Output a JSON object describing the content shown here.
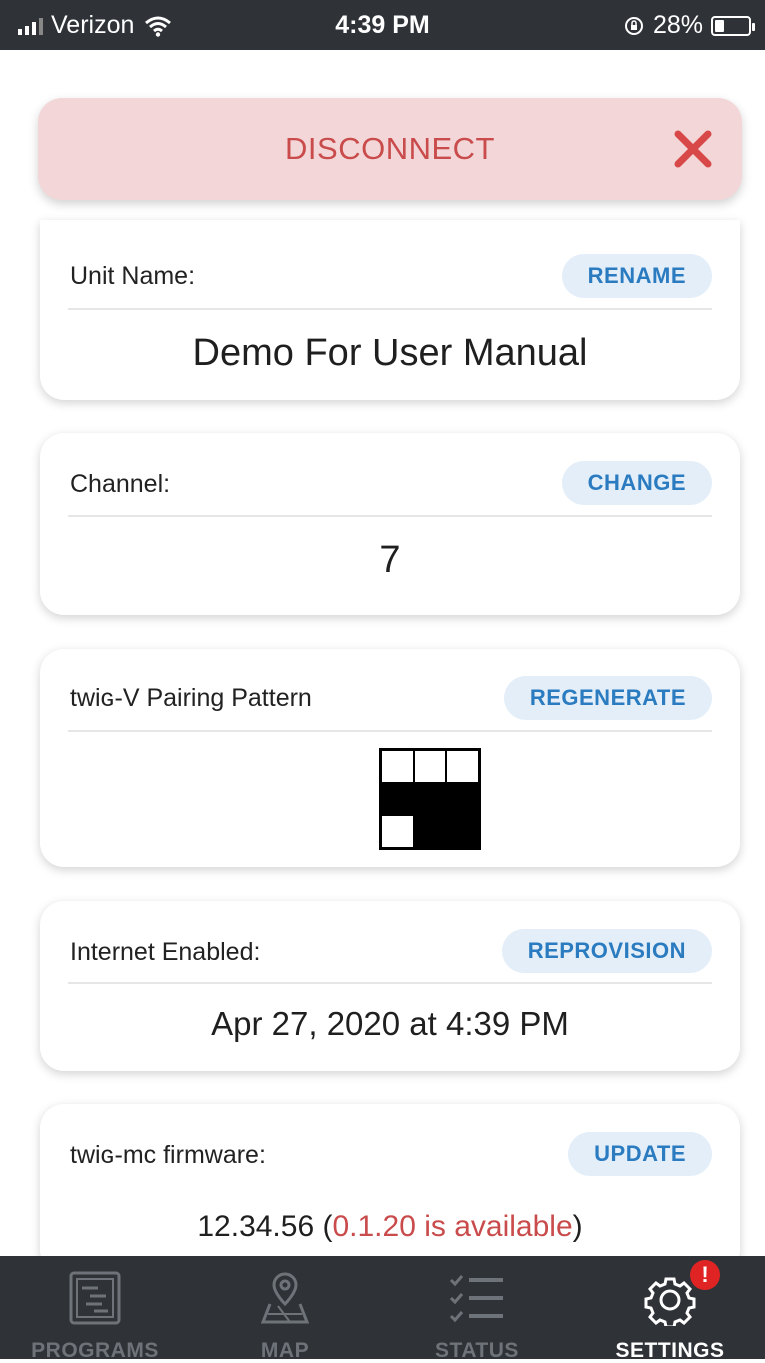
{
  "status_bar": {
    "carrier": "Verizon",
    "time": "4:39 PM",
    "battery": "28%",
    "battery_level": 0.28
  },
  "disconnect": {
    "label": "DISCONNECT",
    "close_icon": "close-icon",
    "color": "#c94b4b"
  },
  "unit": {
    "label": "Unit Name:",
    "button": "RENAME",
    "value": "Demo For User Manual"
  },
  "channel": {
    "label": "Channel:",
    "button": "CHANGE",
    "value": "7"
  },
  "pairing": {
    "label": "twiɢ-V Pairing Pattern",
    "button": "REGENERATE",
    "pattern": [
      [
        0,
        0,
        0
      ],
      [
        1,
        1,
        1
      ],
      [
        0,
        1,
        1
      ]
    ]
  },
  "internet": {
    "label": "Internet Enabled:",
    "button": "REPROVISION",
    "value": "Apr 27, 2020 at 4:39 PM"
  },
  "firmware": {
    "label": "twiɢ-mc firmware:",
    "button": "UPDATE",
    "current": "12.34.56",
    "open": " (",
    "available": "0.1.20 is available",
    "close": ")"
  },
  "tabs": [
    {
      "label": "PROGRAMS",
      "icon": "programs-icon",
      "active": false
    },
    {
      "label": "MAP",
      "icon": "map-pin-icon",
      "active": false
    },
    {
      "label": "STATUS",
      "icon": "checklist-icon",
      "active": false
    },
    {
      "label": "SETTINGS",
      "icon": "gear-icon",
      "active": true,
      "badge": "!"
    }
  ],
  "colors": {
    "accent": "#2a7bc0",
    "accent_bg": "#e3eef8",
    "danger": "#c94b4b",
    "danger_bg": "#f3d6d8",
    "bar": "#2f3338"
  }
}
